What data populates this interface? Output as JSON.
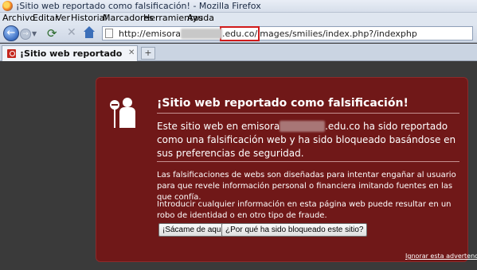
{
  "window": {
    "title": "¡Sitio web reportado como falsificación! - Mozilla Firefox"
  },
  "menu": {
    "items": [
      "Archivo",
      "Editar",
      "Ver",
      "Historial",
      "Marcadores",
      "Herramientas",
      "Ayuda"
    ]
  },
  "navbar": {
    "url_prefix": "http://emisora",
    "url_redacted": "xxxxxxxx",
    "url_highlight": ".edu.co/",
    "url_suffix": "images/smilies/index.php?/indexphp"
  },
  "tabs": [
    {
      "label": "¡Sitio web reportado como falsificaci..."
    }
  ],
  "warning": {
    "title": "¡Sitio web reportado como falsificación!",
    "lead_prefix": "Este sitio web en emisora",
    "lead_redacted": "xxxxxxxx",
    "lead_suffix": ".edu.co ha sido reportado como una falsificación web y ha sido bloqueado basándose en sus preferencias de seguridad.",
    "paragraph_1": "Las falsificaciones de webs son diseñadas para intentar engañar al usuario para que revele información personal o financiera imitando fuentes en las que confía.",
    "paragraph_2": "Introducir cualquier información en esta página web puede resultar en un robo de identidad o en otro tipo de fraude.",
    "button_get_me_out": "¡Sácame de aquí!",
    "button_why_blocked": "¿Por qué ha sido bloqueado este sitio?",
    "ignore_link": "Ignorar esta advertencia"
  },
  "colors": {
    "warning_background": "#701818",
    "page_background": "#3a3a3a"
  }
}
